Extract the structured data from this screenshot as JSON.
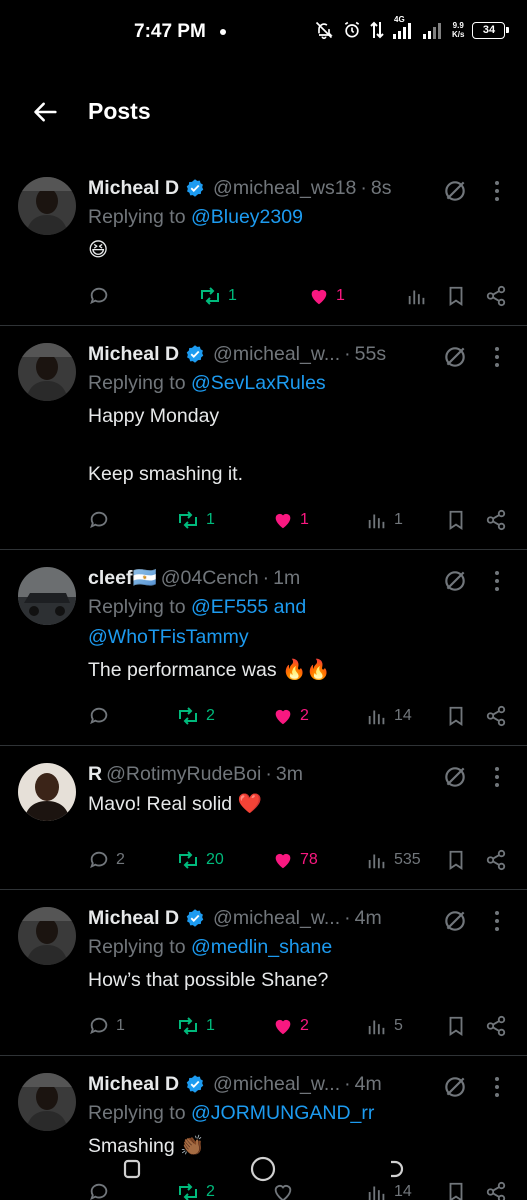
{
  "status_bar": {
    "time": "7:47 PM",
    "network_label": "4G",
    "net_speed_value": "9.9",
    "net_speed_unit": "K/s",
    "battery": "34"
  },
  "header": {
    "title": "Posts",
    "back_icon": "arrow-left-icon"
  },
  "colors": {
    "background": "#000000",
    "text": "#e7e9ea",
    "muted": "#71767b",
    "link": "#1d9bf0",
    "retweet": "#00ba7c",
    "like": "#f91880",
    "divider": "#2f3336"
  },
  "posts": [
    {
      "name": "Micheal D",
      "verified": true,
      "handle": "@micheal_ws18",
      "time": "8s",
      "replying_prefix": "Replying to",
      "replying_to": "@Bluey2309",
      "text": [
        "😆"
      ],
      "reply_count": "",
      "retweet_count": "1",
      "like_count": "1",
      "view_count": ""
    },
    {
      "name": "Micheal D",
      "verified": true,
      "handle": "@micheal_w...",
      "time": "55s",
      "replying_prefix": "Replying to",
      "replying_to": "@SevLaxRules",
      "text": [
        "Happy Monday",
        "",
        "Keep smashing it."
      ],
      "reply_count": "",
      "retweet_count": "1",
      "like_count": "1",
      "view_count": "1"
    },
    {
      "name": "cleef🇦🇷",
      "verified": false,
      "handle": "@04Cench",
      "time": "1m",
      "replying_prefix": "Replying to",
      "replying_to": "@EF555 and",
      "replying_to_2": "@WhoTFisTammy",
      "text": [
        "The performance was 🔥🔥"
      ],
      "reply_count": "",
      "retweet_count": "2",
      "like_count": "2",
      "view_count": "14"
    },
    {
      "name": "R",
      "verified": false,
      "handle": "@RotimyRudeBoi",
      "time": "3m",
      "text": [
        "Mavo! Real solid ❤️"
      ],
      "reply_count": "2",
      "retweet_count": "20",
      "like_count": "78",
      "view_count": "535"
    },
    {
      "name": "Micheal D",
      "verified": true,
      "handle": "@micheal_w...",
      "time": "4m",
      "replying_prefix": "Replying to",
      "replying_to": "@medlin_shane",
      "text": [
        "How’s that possible Shane?"
      ],
      "reply_count": "1",
      "retweet_count": "1",
      "like_count": "2",
      "view_count": "5"
    },
    {
      "name": "Micheal D",
      "verified": true,
      "handle": "@micheal_w...",
      "time": "4m",
      "replying_prefix": "Replying to",
      "replying_to": "@JORMUNGAND_rr",
      "text": [
        "Smashing 👏🏾"
      ],
      "reply_count": "",
      "retweet_count": "2",
      "like_count": "",
      "view_count": "14"
    }
  ],
  "nav_bar": {
    "items": [
      "recent-apps-icon",
      "home-circle-icon",
      "back-gesture-icon"
    ]
  }
}
